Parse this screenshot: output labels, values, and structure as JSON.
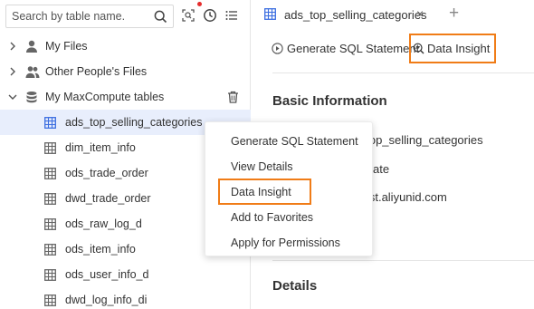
{
  "search": {
    "placeholder": "Search by table name."
  },
  "tree": {
    "my_files": "My Files",
    "other_files": "Other People's Files",
    "maxcompute": "My MaxCompute tables",
    "tables": [
      "ads_top_selling_categories",
      "dim_item_info",
      "ods_trade_order",
      "dwd_trade_order",
      "ods_raw_log_d",
      "ods_item_info",
      "ods_user_info_d",
      "dwd_log_info_di"
    ]
  },
  "tab": {
    "label": "ads_top_selling_categories",
    "close": "×",
    "add": "+"
  },
  "toolbar": {
    "generate_sql": "Generate SQL Statement",
    "data_insight": "Data Insight"
  },
  "main": {
    "basic_info_title": "Basic Information",
    "table_name_partial": "_top_selling_categories",
    "type_partial": "ate",
    "owner_partial": "test.aliyunid.com",
    "details_title": "Details"
  },
  "context_menu": {
    "items": [
      "Generate SQL Statement",
      "View Details",
      "Data Insight",
      "Add to Favorites",
      "Apply for Permissions"
    ]
  },
  "colors": {
    "accent": "#f07c17",
    "selected_row": "#e8eefc",
    "notification": "#e62c2c",
    "table_icon_blue": "#3c6ee0"
  }
}
